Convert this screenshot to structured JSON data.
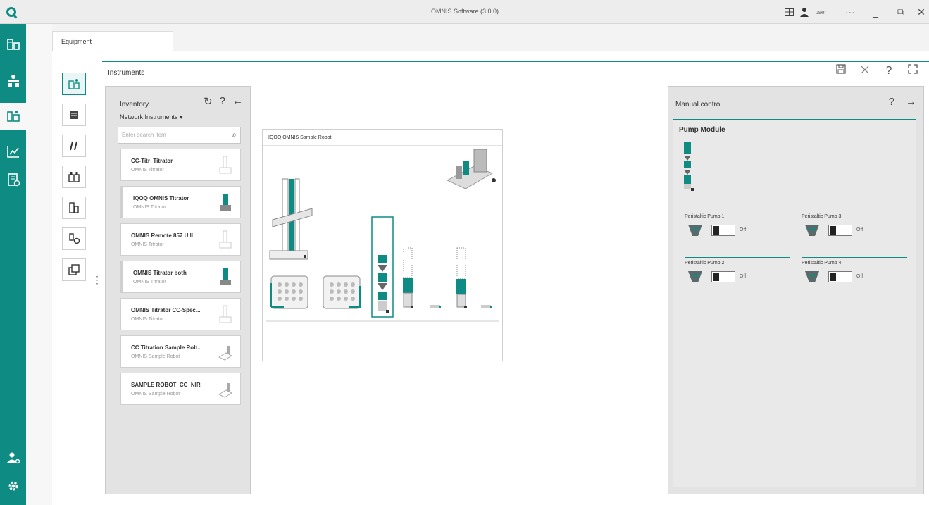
{
  "window": {
    "title": "OMNIS Software (3.0.0)",
    "user_name": "user",
    "more": "···",
    "minimize": "_",
    "restore": "⧉",
    "close": "✕"
  },
  "tabs": {
    "equipment": "Equipment"
  },
  "instruments": {
    "title": "Instruments",
    "save_icon": "save-icon",
    "close_icon": "close-icon",
    "help": "?",
    "expand_icon": "expand-icon"
  },
  "inventory": {
    "title": "Inventory",
    "refresh": "↻",
    "help": "?",
    "collapse": "←",
    "filter": "Network Instruments ▾",
    "search_placeholder": "Enter search item",
    "search_icon": "⌕",
    "items": [
      {
        "name": "CC-Titr_Titrator",
        "type": "OMNIS Titrator"
      },
      {
        "name": "IQOQ OMNIS Titrator",
        "type": "OMNIS Titrator"
      },
      {
        "name": "OMNIS Remote 857 U II",
        "type": "OMNIS Titrator"
      },
      {
        "name": "OMNIS Titrator both",
        "type": "OMNIS Titrator"
      },
      {
        "name": "OMNIS Titrator CC-Spec...",
        "type": "OMNIS Titrator"
      },
      {
        "name": "CC Titration Sample Rob...",
        "type": "OMNIS Sample Robot"
      },
      {
        "name": "SAMPLE ROBOT_CC_NIR",
        "type": "OMNIS Sample Robot"
      }
    ]
  },
  "robot": {
    "title": "IQOQ OMNIS Sample Robot"
  },
  "manual": {
    "title": "Manual control",
    "help": "?",
    "expand": "→",
    "module_title": "Pump Module",
    "pumps": [
      {
        "name": "Peristaltic Pump 1",
        "state": "Off"
      },
      {
        "name": "Peristaltic Pump 3",
        "state": "Off"
      },
      {
        "name": "Peristaltic Pump 2",
        "state": "Off"
      },
      {
        "name": "Peristaltic Pump 4",
        "state": "Off"
      }
    ]
  },
  "colors": {
    "accent": "#0e8c84",
    "panel": "#e3e3e3"
  }
}
